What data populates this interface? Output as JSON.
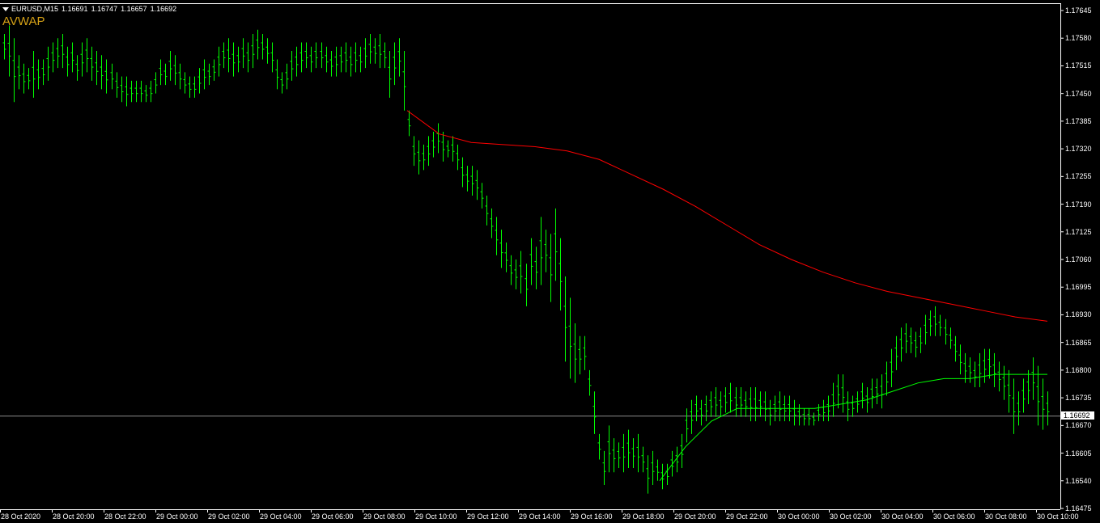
{
  "header": {
    "symbol": "EURUSD,M15",
    "open": "1.16691",
    "high": "1.16747",
    "low": "1.16657",
    "close": "1.16692"
  },
  "indicator": {
    "name": "AVWAP",
    "color": "#d4a017"
  },
  "colors": {
    "background": "#000000",
    "bars": "#00ff00",
    "vwap_red": "#ff0000",
    "vwap_green": "#00ff00",
    "axis": "#ffffff",
    "price_line": "#8a8a8a"
  },
  "current_price": "1.16692",
  "y_axis": {
    "labels": [
      "1.17645",
      "1.17580",
      "1.17515",
      "1.17450",
      "1.17385",
      "1.17320",
      "1.17255",
      "1.17190",
      "1.17125",
      "1.17060",
      "1.16995",
      "1.16930",
      "1.16865",
      "1.16800",
      "1.16735",
      "1.16670",
      "1.16605",
      "1.16540",
      "1.16475"
    ]
  },
  "x_axis": {
    "labels": [
      "28 Oct 2020",
      "28 Oct 20:00",
      "28 Oct 22:00",
      "29 Oct 00:00",
      "29 Oct 02:00",
      "29 Oct 04:00",
      "29 Oct 06:00",
      "29 Oct 08:00",
      "29 Oct 10:00",
      "29 Oct 12:00",
      "29 Oct 14:00",
      "29 Oct 16:00",
      "29 Oct 18:00",
      "29 Oct 20:00",
      "29 Oct 22:00",
      "30 Oct 00:00",
      "30 Oct 02:00",
      "30 Oct 04:00",
      "30 Oct 06:00",
      "30 Oct 08:00",
      "30 Oct 10:00"
    ]
  },
  "chart_data": {
    "type": "ohlc",
    "ylim": [
      1.16475,
      1.17645
    ],
    "bars_high_low": [
      [
        1.1759,
        1.1753
      ],
      [
        1.1761,
        1.1749
      ],
      [
        1.1758,
        1.1743
      ],
      [
        1.1754,
        1.1746
      ],
      [
        1.1752,
        1.1745
      ],
      [
        1.1751,
        1.1746
      ],
      [
        1.1755,
        1.1744
      ],
      [
        1.1753,
        1.1746
      ],
      [
        1.1753,
        1.1747
      ],
      [
        1.1756,
        1.1748
      ],
      [
        1.1757,
        1.175
      ],
      [
        1.1758,
        1.1751
      ],
      [
        1.1759,
        1.1751
      ],
      [
        1.1756,
        1.1749
      ],
      [
        1.1757,
        1.175
      ],
      [
        1.1754,
        1.1748
      ],
      [
        1.1757,
        1.1749
      ],
      [
        1.1758,
        1.175
      ],
      [
        1.1756,
        1.1748
      ],
      [
        1.1755,
        1.1747
      ],
      [
        1.1754,
        1.1746
      ],
      [
        1.1753,
        1.1745
      ],
      [
        1.1752,
        1.1746
      ],
      [
        1.175,
        1.1744
      ],
      [
        1.1749,
        1.1743
      ],
      [
        1.1749,
        1.1742
      ],
      [
        1.1748,
        1.1743
      ],
      [
        1.1748,
        1.1743
      ],
      [
        1.1748,
        1.1743
      ],
      [
        1.1747,
        1.1743
      ],
      [
        1.1748,
        1.1743
      ],
      [
        1.175,
        1.1745
      ],
      [
        1.1753,
        1.1747
      ],
      [
        1.1752,
        1.1747
      ],
      [
        1.1755,
        1.1748
      ],
      [
        1.1754,
        1.1747
      ],
      [
        1.1752,
        1.1746
      ],
      [
        1.175,
        1.1745
      ],
      [
        1.1749,
        1.1744
      ],
      [
        1.1749,
        1.1744
      ],
      [
        1.1751,
        1.1745
      ],
      [
        1.1753,
        1.1746
      ],
      [
        1.1752,
        1.1747
      ],
      [
        1.1753,
        1.1748
      ],
      [
        1.1756,
        1.1749
      ],
      [
        1.1757,
        1.1751
      ],
      [
        1.1758,
        1.175
      ],
      [
        1.1757,
        1.1749
      ],
      [
        1.1756,
        1.175
      ],
      [
        1.1758,
        1.1751
      ],
      [
        1.1757,
        1.175
      ],
      [
        1.1759,
        1.1751
      ],
      [
        1.176,
        1.1753
      ],
      [
        1.1759,
        1.1753
      ],
      [
        1.1758,
        1.1752
      ],
      [
        1.1757,
        1.175
      ],
      [
        1.1753,
        1.1746
      ],
      [
        1.175,
        1.1745
      ],
      [
        1.1752,
        1.1746
      ],
      [
        1.1755,
        1.1748
      ],
      [
        1.1756,
        1.1749
      ],
      [
        1.1757,
        1.175
      ],
      [
        1.1757,
        1.1751
      ],
      [
        1.1756,
        1.175
      ],
      [
        1.1757,
        1.1751
      ],
      [
        1.1757,
        1.1751
      ],
      [
        1.1756,
        1.175
      ],
      [
        1.1755,
        1.1749
      ],
      [
        1.1756,
        1.1749
      ],
      [
        1.1756,
        1.175
      ],
      [
        1.1757,
        1.175
      ],
      [
        1.1756,
        1.1749
      ],
      [
        1.1757,
        1.175
      ],
      [
        1.1756,
        1.175
      ],
      [
        1.1758,
        1.1751
      ],
      [
        1.1759,
        1.1752
      ],
      [
        1.1758,
        1.1752
      ],
      [
        1.1759,
        1.1751
      ],
      [
        1.1757,
        1.1751
      ],
      [
        1.1755,
        1.1744
      ],
      [
        1.1757,
        1.1747
      ],
      [
        1.1758,
        1.1749
      ],
      [
        1.1755,
        1.1741
      ],
      [
        1.1741,
        1.1735
      ],
      [
        1.1735,
        1.1728
      ],
      [
        1.1734,
        1.1726
      ],
      [
        1.1733,
        1.1727
      ],
      [
        1.1735,
        1.1728
      ],
      [
        1.1736,
        1.173
      ],
      [
        1.1738,
        1.1731
      ],
      [
        1.1736,
        1.1729
      ],
      [
        1.1734,
        1.173
      ],
      [
        1.1735,
        1.1729
      ],
      [
        1.1733,
        1.1727
      ],
      [
        1.173,
        1.1723
      ],
      [
        1.1728,
        1.1722
      ],
      [
        1.1728,
        1.1721
      ],
      [
        1.1727,
        1.172
      ],
      [
        1.1724,
        1.1718
      ],
      [
        1.1721,
        1.1714
      ],
      [
        1.1718,
        1.1711
      ],
      [
        1.1716,
        1.1707
      ],
      [
        1.1713,
        1.1704
      ],
      [
        1.171,
        1.1703
      ],
      [
        1.1707,
        1.17
      ],
      [
        1.1706,
        1.1699
      ],
      [
        1.1708,
        1.1698
      ],
      [
        1.1705,
        1.1695
      ],
      [
        1.1711,
        1.17
      ],
      [
        1.1709,
        1.1699
      ],
      [
        1.1716,
        1.17
      ],
      [
        1.1713,
        1.1703
      ],
      [
        1.1712,
        1.1696
      ],
      [
        1.1718,
        1.1701
      ],
      [
        1.1711,
        1.1694
      ],
      [
        1.1702,
        1.1682
      ],
      [
        1.1697,
        1.1678
      ],
      [
        1.1691,
        1.1677
      ],
      [
        1.1688,
        1.1679
      ],
      [
        1.1688,
        1.168
      ],
      [
        1.168,
        1.1674
      ],
      [
        1.1675,
        1.1665
      ],
      [
        1.1665,
        1.1659
      ],
      [
        1.1661,
        1.1653
      ],
      [
        1.1667,
        1.1656
      ],
      [
        1.1664,
        1.1656
      ],
      [
        1.1663,
        1.1657
      ],
      [
        1.1665,
        1.1656
      ],
      [
        1.1666,
        1.1657
      ],
      [
        1.1664,
        1.1657
      ],
      [
        1.1665,
        1.1656
      ],
      [
        1.1662,
        1.1656
      ],
      [
        1.166,
        1.1651
      ],
      [
        1.1661,
        1.1653
      ],
      [
        1.1659,
        1.1654
      ],
      [
        1.1658,
        1.1652
      ],
      [
        1.1658,
        1.1653
      ],
      [
        1.1661,
        1.1655
      ],
      [
        1.1662,
        1.1656
      ],
      [
        1.1665,
        1.1657
      ],
      [
        1.1671,
        1.1663
      ],
      [
        1.1673,
        1.1665
      ],
      [
        1.1674,
        1.1668
      ],
      [
        1.1673,
        1.1667
      ],
      [
        1.1674,
        1.1668
      ],
      [
        1.1675,
        1.1669
      ],
      [
        1.1676,
        1.1669
      ],
      [
        1.1675,
        1.1669
      ],
      [
        1.1676,
        1.167
      ],
      [
        1.1677,
        1.167
      ],
      [
        1.1676,
        1.1669
      ],
      [
        1.1676,
        1.1669
      ],
      [
        1.1675,
        1.1669
      ],
      [
        1.1676,
        1.1668
      ],
      [
        1.1676,
        1.1668
      ],
      [
        1.1675,
        1.1669
      ],
      [
        1.1675,
        1.1668
      ],
      [
        1.1673,
        1.1667
      ],
      [
        1.1674,
        1.1668
      ],
      [
        1.1675,
        1.1668
      ],
      [
        1.1674,
        1.1668
      ],
      [
        1.1674,
        1.1668
      ],
      [
        1.1673,
        1.1667
      ],
      [
        1.1672,
        1.1667
      ],
      [
        1.1671,
        1.1667
      ],
      [
        1.1671,
        1.1667
      ],
      [
        1.167,
        1.1667
      ],
      [
        1.1672,
        1.1668
      ],
      [
        1.1673,
        1.1668
      ],
      [
        1.1674,
        1.1668
      ],
      [
        1.1677,
        1.1669
      ],
      [
        1.1679,
        1.1671
      ],
      [
        1.1679,
        1.167
      ],
      [
        1.1675,
        1.1668
      ],
      [
        1.1674,
        1.1669
      ],
      [
        1.1675,
        1.167
      ],
      [
        1.1677,
        1.1671
      ],
      [
        1.1676,
        1.167
      ],
      [
        1.1678,
        1.1671
      ],
      [
        1.1678,
        1.1672
      ],
      [
        1.1679,
        1.1671
      ],
      [
        1.1682,
        1.1674
      ],
      [
        1.1685,
        1.1676
      ],
      [
        1.1688,
        1.168
      ],
      [
        1.169,
        1.1682
      ],
      [
        1.1691,
        1.1684
      ],
      [
        1.169,
        1.1684
      ],
      [
        1.1689,
        1.1683
      ],
      [
        1.169,
        1.1684
      ],
      [
        1.1693,
        1.1686
      ],
      [
        1.1694,
        1.1688
      ],
      [
        1.1695,
        1.1688
      ],
      [
        1.1693,
        1.1688
      ],
      [
        1.1692,
        1.1686
      ],
      [
        1.169,
        1.1685
      ],
      [
        1.1688,
        1.1682
      ],
      [
        1.1686,
        1.1679
      ],
      [
        1.1684,
        1.1677
      ],
      [
        1.1683,
        1.1677
      ],
      [
        1.1682,
        1.1676
      ],
      [
        1.1684,
        1.1676
      ],
      [
        1.1685,
        1.1677
      ],
      [
        1.1685,
        1.1678
      ],
      [
        1.1684,
        1.1676
      ],
      [
        1.1682,
        1.1675
      ],
      [
        1.1681,
        1.1673
      ],
      [
        1.168,
        1.167
      ],
      [
        1.1678,
        1.1665
      ],
      [
        1.1675,
        1.1667
      ],
      [
        1.1678,
        1.167
      ],
      [
        1.168,
        1.1672
      ],
      [
        1.1683,
        1.1673
      ],
      [
        1.1681,
        1.1667
      ],
      [
        1.1678,
        1.1666
      ],
      [
        1.1675,
        1.1667
      ]
    ],
    "vwap_red": [
      1.1741,
      1.17355,
      1.17335,
      1.1733,
      1.17325,
      1.17315,
      1.17295,
      1.1726,
      1.17225,
      1.17185,
      1.1714,
      1.17095,
      1.1706,
      1.1703,
      1.17005,
      1.16985,
      1.1697,
      1.16955,
      1.1694,
      1.16925,
      1.16915
    ],
    "vwap_green": [
      1.1654,
      1.1662,
      1.1668,
      1.1671,
      1.1671,
      1.1671,
      1.1671,
      1.1672,
      1.1673,
      1.1675,
      1.1677,
      1.1678,
      1.1678,
      1.1679,
      1.1679,
      1.1679
    ]
  }
}
